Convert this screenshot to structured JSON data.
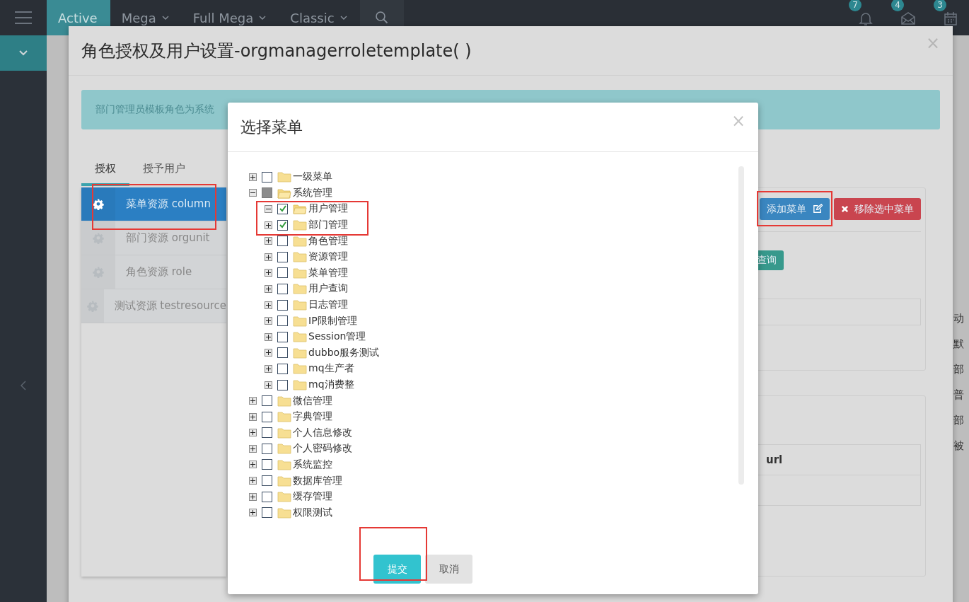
{
  "navbar": {
    "tabs": [
      {
        "label": "Active",
        "selected": true,
        "dropdown": false
      },
      {
        "label": "Mega",
        "selected": false,
        "dropdown": true
      },
      {
        "label": "Full Mega",
        "selected": false,
        "dropdown": true
      },
      {
        "label": "Classic",
        "selected": false,
        "dropdown": true
      }
    ],
    "notifications": [
      {
        "kind": "bell",
        "count": "7"
      },
      {
        "kind": "mail",
        "count": "4"
      },
      {
        "kind": "calendar",
        "count": "3"
      }
    ]
  },
  "background_fragments": [
    "动",
    "默",
    "部",
    "普",
    "部",
    "被"
  ],
  "role_dialog": {
    "title": "角色授权及用户设置-orgmanagerroletemplate( )",
    "close": "×",
    "alert": "部门管理员模板角色为系统",
    "tabs": [
      {
        "label": "授权",
        "selected": true
      },
      {
        "label": "授予用户",
        "selected": false
      }
    ],
    "resources": [
      {
        "label": "菜单资源 column",
        "selected": true
      },
      {
        "label": "部门资源 orgunit",
        "selected": false
      },
      {
        "label": "角色资源 role",
        "selected": false
      },
      {
        "label": "测试资源 testresource",
        "selected": false
      }
    ],
    "add_button": "添加菜单",
    "remove_button": "移除选中菜单",
    "query_button": "查询",
    "table_column": "url"
  },
  "menu_dialog": {
    "title": "选择菜单",
    "close": "×",
    "tree": {
      "items": [
        {
          "label": "一级菜单",
          "expanded": false,
          "checked": false,
          "partial": false
        },
        {
          "label": "系统管理",
          "expanded": true,
          "checked": true,
          "partial": true,
          "children": [
            {
              "label": "用户管理",
              "expanded": true,
              "checked": true,
              "partial": false
            },
            {
              "label": "部门管理",
              "expanded": false,
              "checked": true,
              "partial": false
            },
            {
              "label": "角色管理",
              "expanded": false,
              "checked": false,
              "partial": false
            },
            {
              "label": "资源管理",
              "expanded": false,
              "checked": false,
              "partial": false
            },
            {
              "label": "菜单管理",
              "expanded": false,
              "checked": false,
              "partial": false
            },
            {
              "label": "用户查询",
              "expanded": false,
              "checked": false,
              "partial": false
            },
            {
              "label": "日志管理",
              "expanded": false,
              "checked": false,
              "partial": false
            },
            {
              "label": "IP限制管理",
              "expanded": false,
              "checked": false,
              "partial": false
            },
            {
              "label": "Session管理",
              "expanded": false,
              "checked": false,
              "partial": false
            },
            {
              "label": "dubbo服务测试",
              "expanded": false,
              "checked": false,
              "partial": false
            },
            {
              "label": "mq生产者",
              "expanded": false,
              "checked": false,
              "partial": false
            },
            {
              "label": "mq消费整",
              "expanded": false,
              "checked": false,
              "partial": false
            }
          ]
        },
        {
          "label": "微信管理",
          "expanded": false,
          "checked": false,
          "partial": false
        },
        {
          "label": "字典管理",
          "expanded": false,
          "checked": false,
          "partial": false
        },
        {
          "label": "个人信息修改",
          "expanded": false,
          "checked": false,
          "partial": false
        },
        {
          "label": "个人密码修改",
          "expanded": false,
          "checked": false,
          "partial": false
        },
        {
          "label": "系统监控",
          "expanded": false,
          "checked": false,
          "partial": false
        },
        {
          "label": "数据库管理",
          "expanded": false,
          "checked": false,
          "partial": false
        },
        {
          "label": "缓存管理",
          "expanded": false,
          "checked": false,
          "partial": false
        },
        {
          "label": "权限测试",
          "expanded": false,
          "checked": false,
          "partial": false
        }
      ]
    },
    "submit_button": "提交",
    "cancel_button": "取消"
  }
}
